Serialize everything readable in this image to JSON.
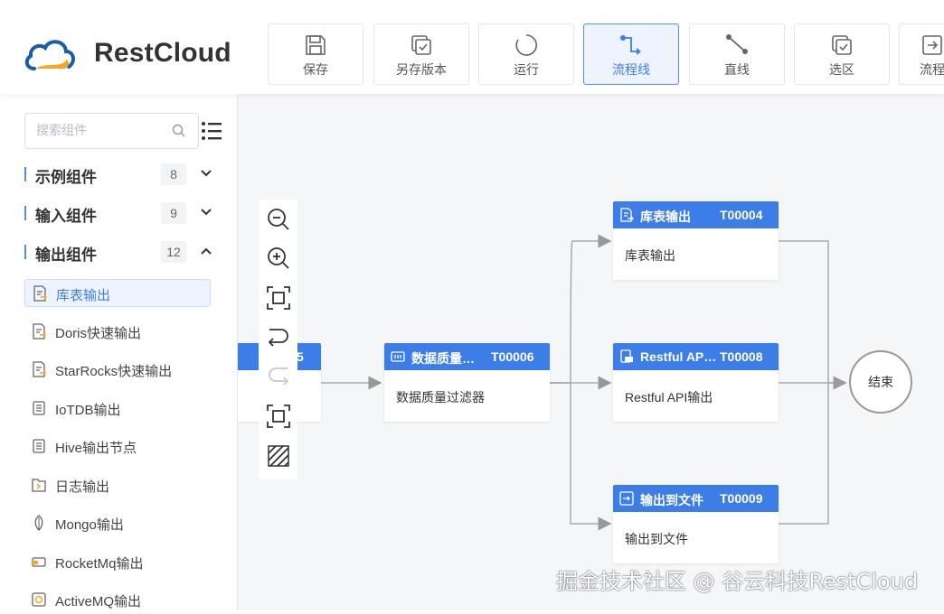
{
  "app": {
    "logo_text": "RestCloud"
  },
  "toolbar": [
    {
      "label": "保存",
      "icon": "save-icon"
    },
    {
      "label": "另存版本",
      "icon": "save-version-icon"
    },
    {
      "label": "运行",
      "icon": "run-icon"
    },
    {
      "label": "流程线",
      "icon": "flow-line-icon",
      "active": true
    },
    {
      "label": "直线",
      "icon": "straight-line-icon"
    },
    {
      "label": "选区",
      "icon": "select-area-icon"
    },
    {
      "label": "流程",
      "icon": "flow-icon"
    }
  ],
  "sidebar": {
    "search_placeholder": "搜索组件",
    "groups": [
      {
        "name": "示例组件",
        "count": "8",
        "expanded": false
      },
      {
        "name": "输入组件",
        "count": "9",
        "expanded": false
      },
      {
        "name": "输出组件",
        "count": "12",
        "expanded": true
      }
    ],
    "items": [
      {
        "name": "库表输出",
        "selected": true
      },
      {
        "name": "Doris快速输出"
      },
      {
        "name": "StarRocks快速输出"
      },
      {
        "name": "IoTDB输出"
      },
      {
        "name": "Hive输出节点"
      },
      {
        "name": "日志输出"
      },
      {
        "name": "Mongo输出"
      },
      {
        "name": "RocketMq输出"
      },
      {
        "name": "ActiveMQ输出"
      }
    ]
  },
  "canvas": {
    "partial_node": {
      "id_tail": "5",
      "body_tail": ""
    },
    "nodes": [
      {
        "title": "数据质量…",
        "id": "T00006",
        "body": "数据质量过滤器"
      },
      {
        "title": "库表输出",
        "id": "T00004",
        "body": "库表输出"
      },
      {
        "title": "Restful AP…",
        "id": "T00008",
        "body": "Restful API输出"
      },
      {
        "title": "输出到文件",
        "id": "T00009",
        "body": "输出到文件"
      }
    ],
    "end_label": "结束"
  },
  "watermark": "掘金技术社区 @ 谷云科技RestCloud",
  "colors": {
    "accent": "#3d7de8",
    "logo_blue": "#1a5ea8",
    "logo_orange": "#f5a623"
  }
}
